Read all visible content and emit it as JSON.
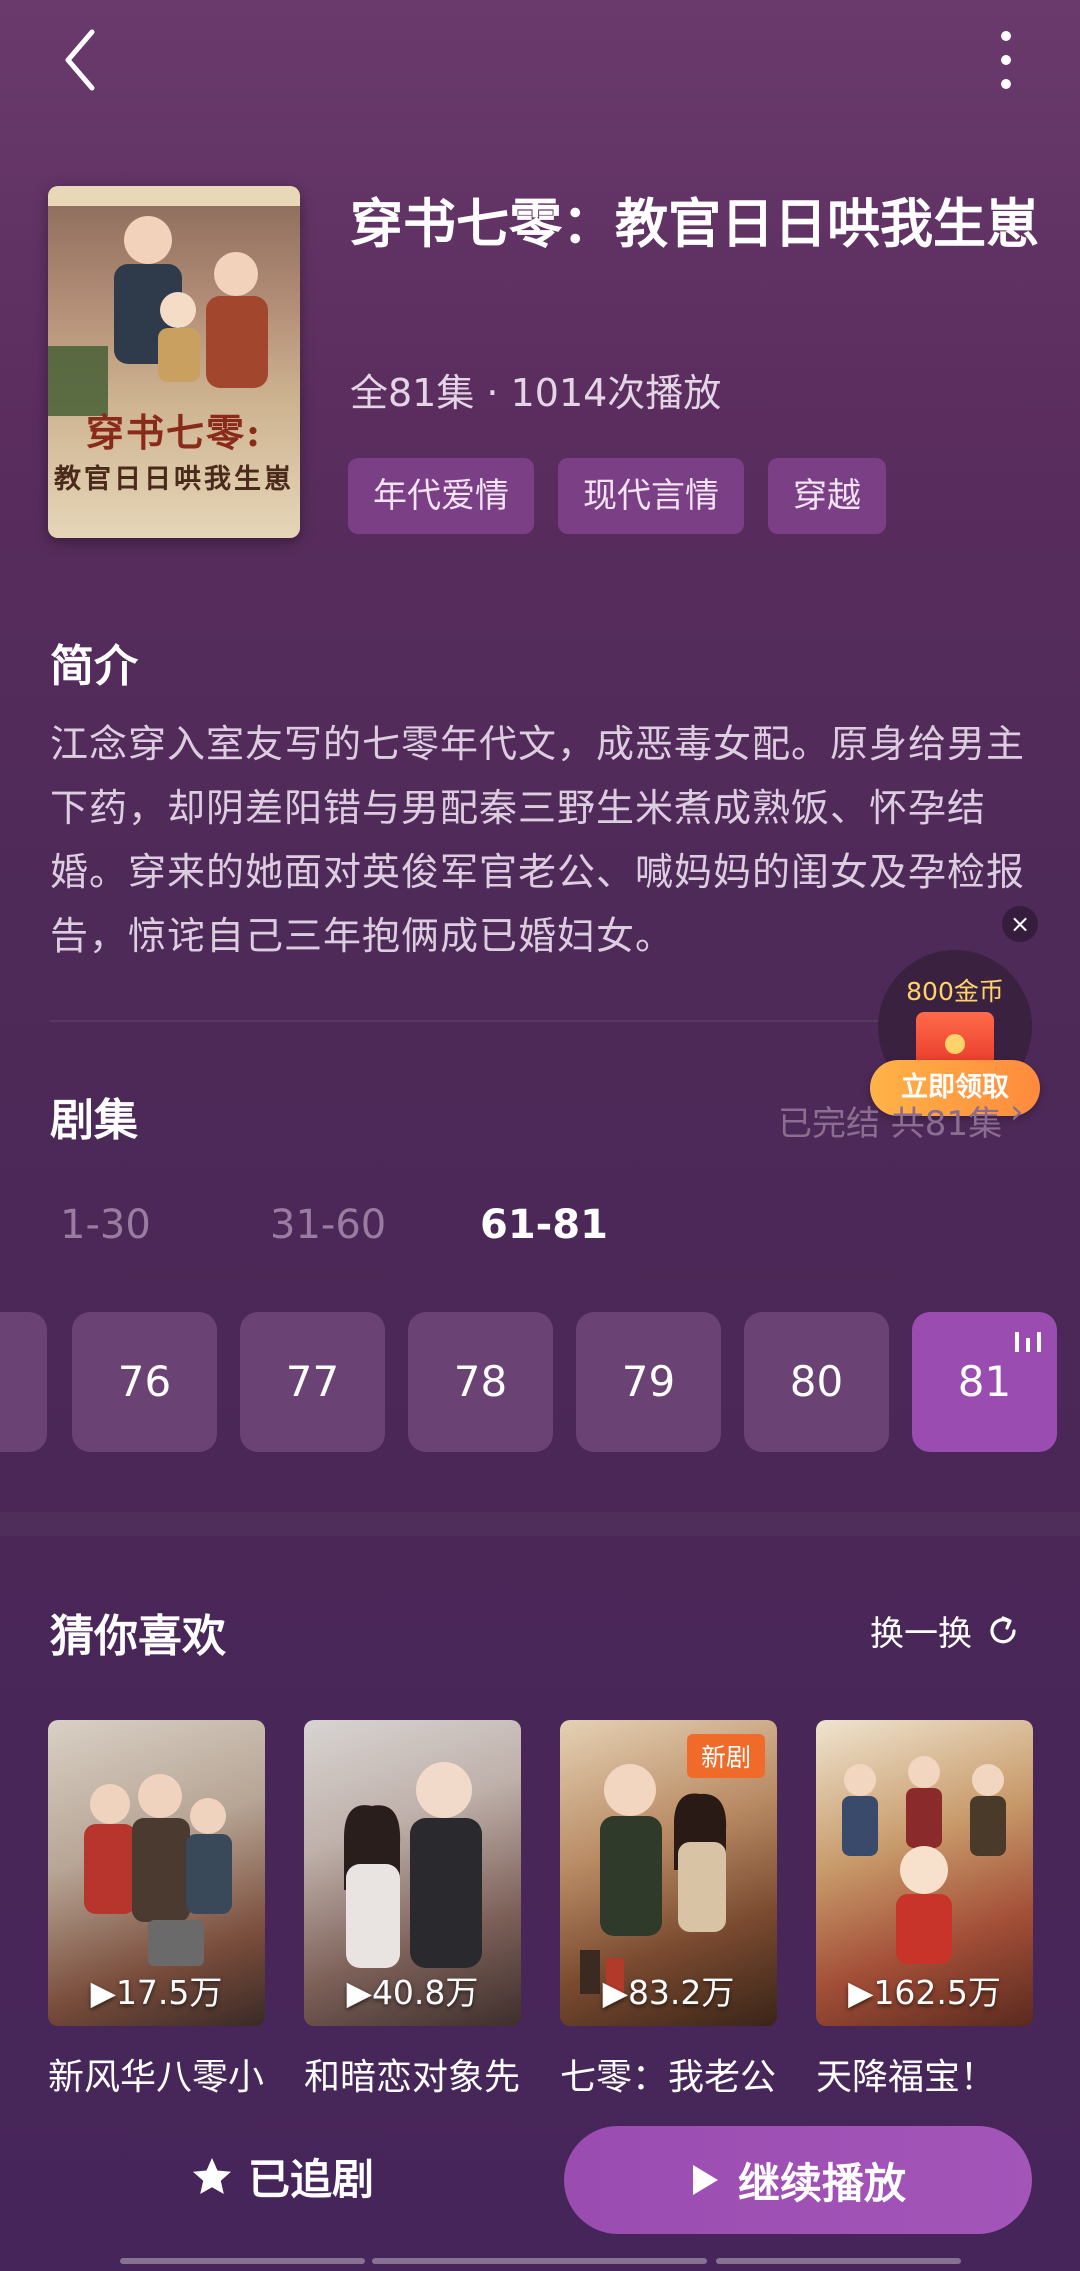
{
  "drama": {
    "title": "穿书七零：教官日日哄我生崽",
    "meta": "全81集 · 1014次播放",
    "tags": [
      "年代爱情",
      "现代言情",
      "穿越"
    ],
    "poster": {
      "title_line1": "穿书七零:",
      "title_line2": "教官日日哄我生崽"
    }
  },
  "intro": {
    "title": "简介",
    "text": "江念穿入室友写的七零年代文，成恶毒女配。原身给男主下药，却阴差阳错与男配秦三野生米煮成熟饭、怀孕结婚。穿来的她面对英俊军官老公、喊妈妈的闺女及孕检报告，惊诧自己三年抱俩成已婚妇女。"
  },
  "coins": {
    "amount": "800金币",
    "claim": "立即领取",
    "close": "×"
  },
  "episodes": {
    "title": "剧集",
    "status": "已完结 共81集",
    "ranges": [
      "1-30",
      "31-60",
      "61-81"
    ],
    "active_range": "61-81",
    "items": [
      "76",
      "77",
      "78",
      "79",
      "80",
      "81"
    ],
    "current": "81"
  },
  "recommend": {
    "title": "猜你喜欢",
    "refresh": "换一换",
    "cards": [
      {
        "title": "新风华八零小娇妻",
        "plays": "▶17.5万"
      },
      {
        "title": "和暗恋对象先婚后爱了",
        "plays": "▶40.8万"
      },
      {
        "title": "七零：我老公是糙汉",
        "plays": "▶83.2万",
        "badge": "新剧"
      },
      {
        "title": "天降福宝！",
        "plays": "▶162.5万"
      }
    ]
  },
  "bottom": {
    "follow": "已追剧",
    "continue": "继续播放"
  },
  "colors": {
    "accent": "#9a4cb0",
    "tag_bg": "#7b3f86",
    "coin_orange": "#ff8a3d",
    "new_badge": "#f06a2a"
  }
}
